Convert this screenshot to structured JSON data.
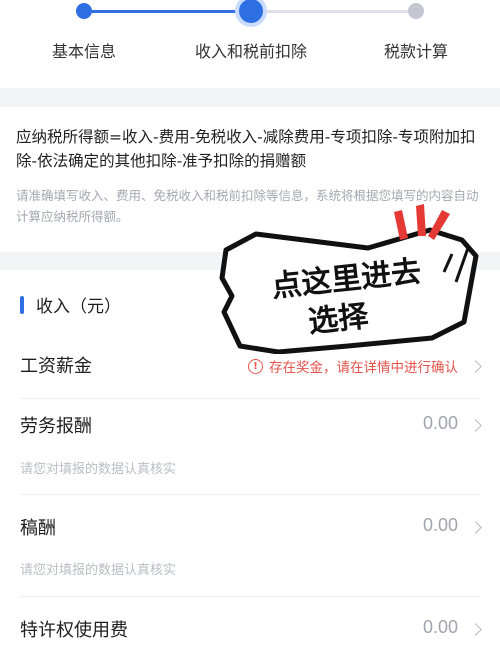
{
  "steps": [
    {
      "label": "基本信息",
      "state": "done"
    },
    {
      "label": "收入和税前扣除",
      "state": "current"
    },
    {
      "label": "税款计算",
      "state": "todo"
    }
  ],
  "formula": {
    "text": "应纳税所得额=收入-费用-免税收入-减除费用-专项扣除-专项附加扣除-依法确定的其他扣除-准予扣除的捐赠额",
    "hint": "请准确填写收入、费用、免税收入和税前扣除等信息，系统将根据您填写的内容自动计算应纳税所得额。"
  },
  "income": {
    "title": "收入（元）",
    "rows": [
      {
        "label": "工资薪金",
        "warning": "存在奖金，请在详情中进行确认"
      },
      {
        "label": "劳务报酬",
        "value": "0.00",
        "hint": "请您对填报的数据认真核实"
      },
      {
        "label": "稿酬",
        "value": "0.00",
        "hint": "请您对填报的数据认真核实"
      },
      {
        "label": "特许权使用费",
        "value": "0.00"
      }
    ]
  },
  "annotation": {
    "line1": "点这里进去",
    "line2": "选择"
  },
  "colors": {
    "accent": "#2f6fe4",
    "warning": "#e5534b",
    "background": "#f3f4f6"
  },
  "icons": {
    "warning": "exclamation-circle-icon",
    "chevron": "chevron-right-icon"
  }
}
